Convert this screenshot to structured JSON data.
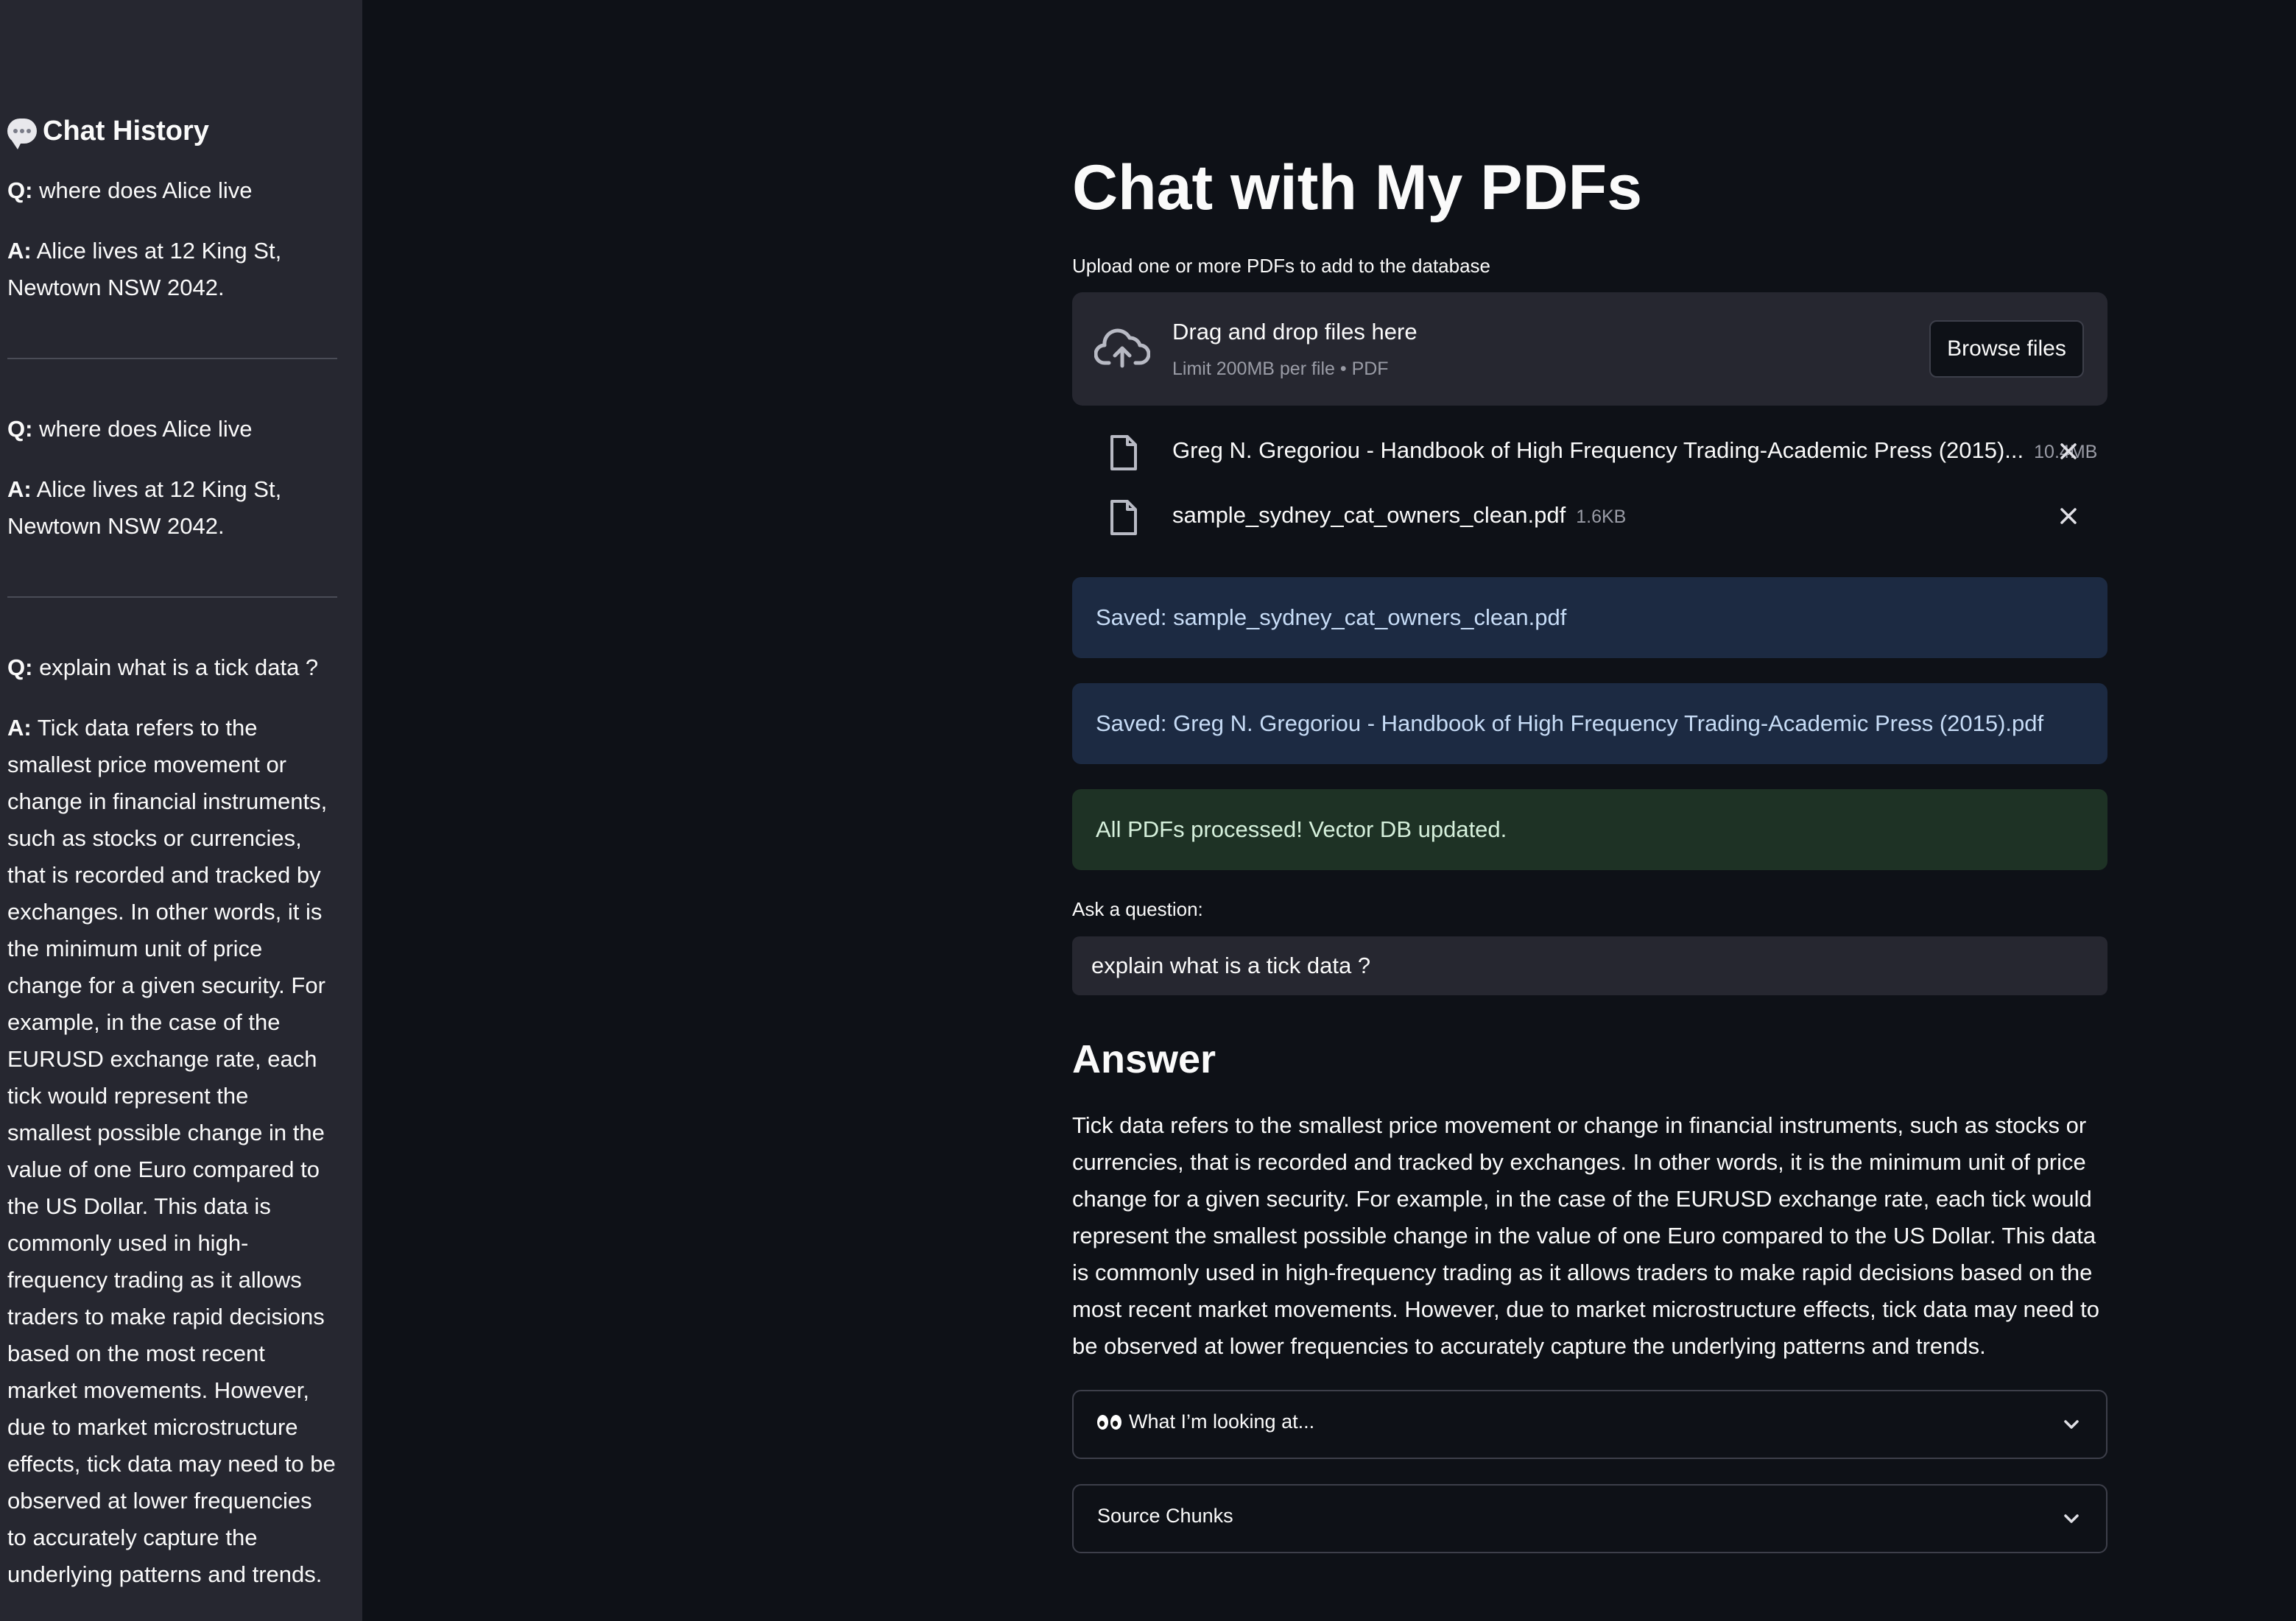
{
  "sidebar": {
    "title": "Chat History",
    "entries": [
      {
        "q_prefix": "Q:",
        "question": "where does Alice live",
        "a_prefix": "A:",
        "answer": "Alice lives at 12 King St, Newtown NSW 2042."
      },
      {
        "q_prefix": "Q:",
        "question": "where does Alice live",
        "a_prefix": "A:",
        "answer": "Alice lives at 12 King St, Newtown NSW 2042."
      },
      {
        "q_prefix": "Q:",
        "question": "explain what is a tick data ?",
        "a_prefix": "A:",
        "answer": "Tick data refers to the smallest price movement or change in financial instruments, such as stocks or currencies, that is recorded and tracked by exchanges. In other words, it is the minimum unit of price change for a given security. For example, in the case of the EURUSD exchange rate, each tick would represent the smallest possible change in the value of one Euro compared to the US Dollar. This data is commonly used in high-frequency trading as it allows traders to make rapid decisions based on the most recent market movements. However, due to market microstructure effects, tick data may need to be observed at lower frequencies to accurately capture the underlying patterns and trends."
      }
    ]
  },
  "main": {
    "title": "Chat with My PDFs",
    "upload_label": "Upload one or more PDFs to add to the database",
    "dropzone": {
      "main_text": "Drag and drop files here",
      "sub_text": "Limit 200MB per file • PDF",
      "browse_label": "Browse files"
    },
    "files": [
      {
        "name": "Greg N. Gregoriou - Handbook of High Frequency Trading-Academic Press (2015)...",
        "size": "10.4MB"
      },
      {
        "name": "sample_sydney_cat_owners_clean.pdf",
        "size": "1.6KB"
      }
    ],
    "alerts": [
      {
        "type": "info",
        "text": "Saved: sample_sydney_cat_owners_clean.pdf"
      },
      {
        "type": "info",
        "text": "Saved: Greg N. Gregoriou - Handbook of High Frequency Trading-Academic Press (2015).pdf"
      },
      {
        "type": "success",
        "text": "All PDFs processed! Vector DB updated."
      }
    ],
    "question_label": "Ask a question:",
    "question_value": "explain what is a tick data ?",
    "answer_heading": "Answer",
    "answer_text": "Tick data refers to the smallest price movement or change in financial instruments, such as stocks or currencies, that is recorded and tracked by exchanges. In other words, it is the minimum unit of price change for a given security. For example, in the case of the EURUSD exchange rate, each tick would represent the smallest possible change in the value of one Euro compared to the US Dollar. This data is commonly used in high-frequency trading as it allows traders to make rapid decisions based on the most recent market movements. However, due to market microstructure effects, tick data may need to be observed at lower frequencies to accurately capture the underlying patterns and trends.",
    "expanders": [
      {
        "label": "What I’m looking at..."
      },
      {
        "label": "Source Chunks"
      }
    ]
  },
  "icons": {
    "chat_history": "speech-bubble-icon",
    "upload": "cloud-upload-icon",
    "file": "file-icon",
    "remove": "close-icon",
    "expand": "chevron-down-icon",
    "eyes": "eyes-icon"
  }
}
